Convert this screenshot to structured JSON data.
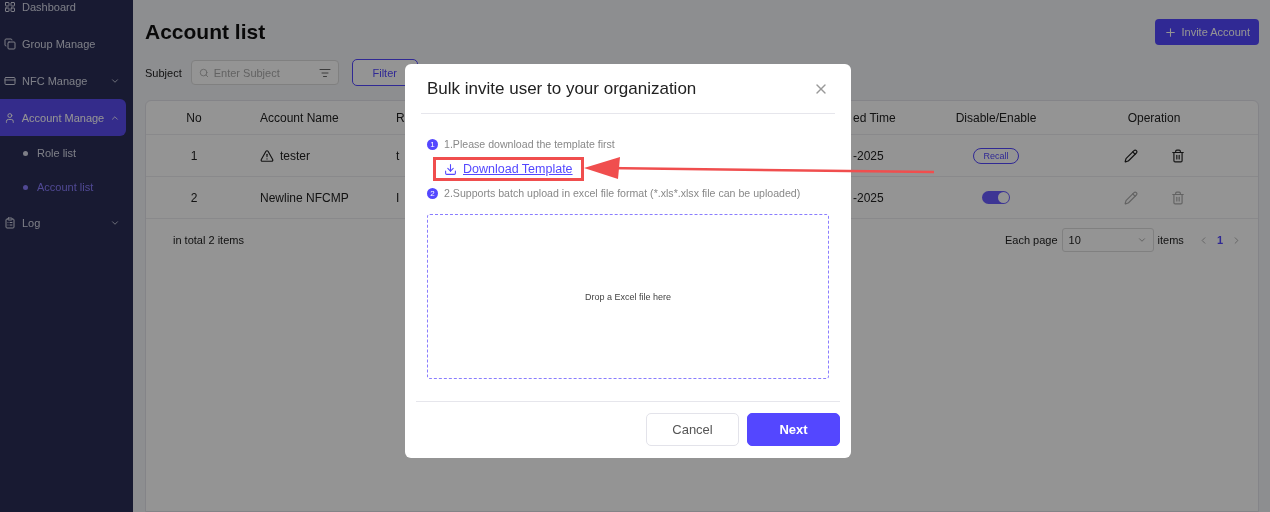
{
  "sidebar": {
    "items": [
      {
        "label": "Dashboard",
        "kind": "link",
        "selected": false
      },
      {
        "label": "Group Manage",
        "kind": "link",
        "selected": false
      },
      {
        "label": "NFC Manage",
        "kind": "menu",
        "selected": false,
        "expanded": false
      },
      {
        "label": "Account Manage",
        "kind": "menu",
        "selected": true,
        "expanded": true,
        "children": [
          {
            "label": "Role list",
            "selected": false
          },
          {
            "label": "Account list",
            "selected": true
          }
        ]
      },
      {
        "label": "Log",
        "kind": "menu",
        "selected": false,
        "expanded": false
      }
    ]
  },
  "page": {
    "title": "Account list",
    "invite_button": "Invite Account",
    "filter": {
      "label": "Subject",
      "placeholder": "Enter Subject",
      "button": "Filter"
    },
    "table": {
      "columns": [
        "No",
        "Account Name",
        "R",
        "ed Time",
        "Disable/Enable",
        "Operation"
      ],
      "rows": [
        {
          "no": "1",
          "account_name": "tester",
          "warning": true,
          "column_3": "t",
          "time": "-2025",
          "status": {
            "kind": "recall",
            "label": "Recall"
          },
          "actions_disabled": false
        },
        {
          "no": "2",
          "account_name": "Newline NFCMP",
          "warning": false,
          "column_3": "I",
          "time": "-2025",
          "status": {
            "kind": "toggle",
            "on": true
          },
          "actions_disabled": true
        }
      ]
    },
    "footer": {
      "total": "in total 2 items",
      "each_page": "Each page",
      "page_size": "10",
      "items": "items",
      "pages": [
        {
          "label": "1",
          "selected": true
        }
      ]
    }
  },
  "modal": {
    "title": "Bulk invite user to your organization",
    "steps": [
      {
        "badge": "1",
        "text": "1.Please download the template first"
      },
      {
        "badge": "2",
        "text": "2.Supports batch upload in excel file format (*.xls*.xlsx file can be uploaded)"
      }
    ],
    "download_link": "Download Template",
    "highlighted": true,
    "dropzone": "Drop a Excel file here",
    "buttons": [
      {
        "label": "Cancel",
        "kind": "secondary"
      },
      {
        "label": "Next",
        "kind": "primary"
      }
    ]
  }
}
